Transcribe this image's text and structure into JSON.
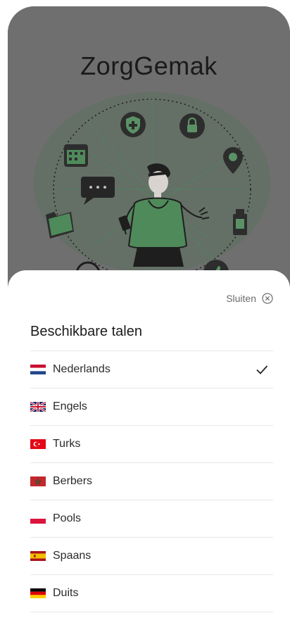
{
  "app": {
    "title": "ZorgGemak"
  },
  "sheet": {
    "close_label": "Sluiten",
    "title": "Beschikbare talen",
    "selected_language": "Nederlands"
  },
  "languages": [
    {
      "label": "Nederlands",
      "flag": "nl-flag-icon",
      "selected": true
    },
    {
      "label": "Engels",
      "flag": "uk-flag-icon",
      "selected": false
    },
    {
      "label": "Turks",
      "flag": "tr-flag-icon",
      "selected": false
    },
    {
      "label": "Berbers",
      "flag": "ma-flag-icon",
      "selected": false
    },
    {
      "label": "Pools",
      "flag": "pl-flag-icon",
      "selected": false
    },
    {
      "label": "Spaans",
      "flag": "es-flag-icon",
      "selected": false
    },
    {
      "label": "Duits",
      "flag": "de-flag-icon",
      "selected": false
    }
  ],
  "colors": {
    "overlay": "#6f6f6f",
    "accent_green": "#4f8a5b",
    "sheet_bg": "#ffffff"
  }
}
